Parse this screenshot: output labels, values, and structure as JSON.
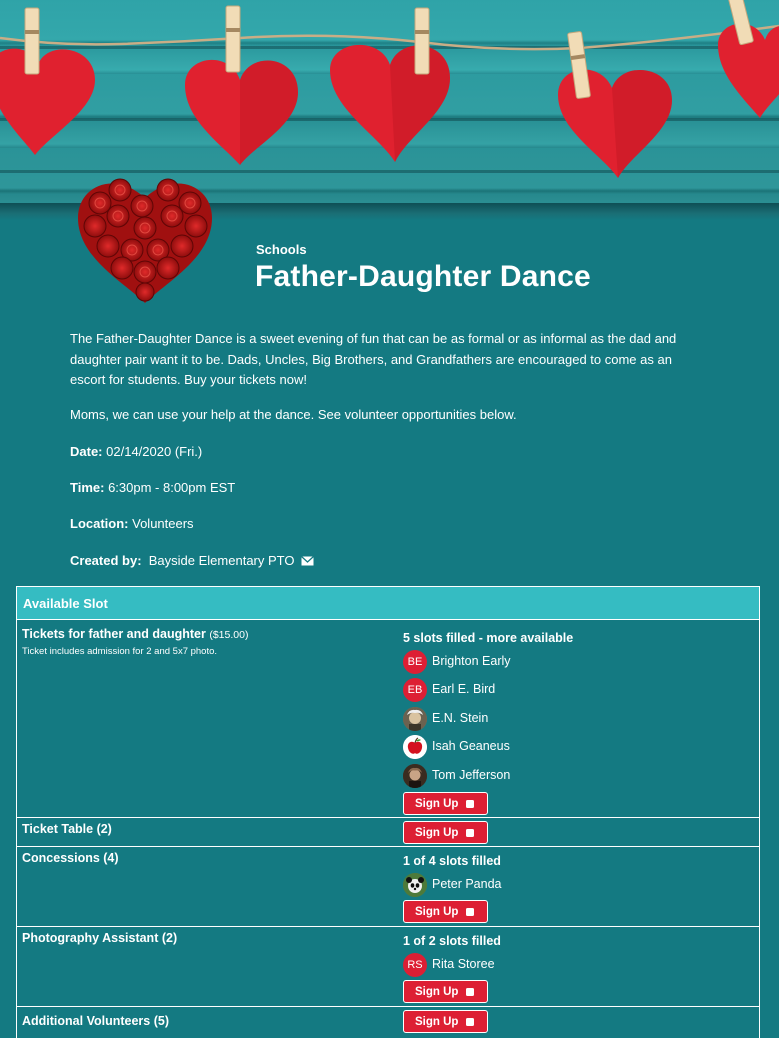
{
  "header": {
    "category": "Schools",
    "title": "Father-Daughter Dance"
  },
  "description": {
    "paragraph1": "The Father-Daughter Dance is a sweet evening of fun that can be as formal or as informal as the dad and daughter pair want it to be. Dads, Uncles, Big Brothers, and Grandfathers are encouraged to come as an escort for students. Buy your tickets now!",
    "paragraph2": "Moms, we can use your help at the dance. See volunteer opportunities below."
  },
  "details": {
    "date_label": "Date:",
    "date_value": "02/14/2020 (Fri.)",
    "time_label": "Time:",
    "time_value": "6:30pm - 8:00pm EST",
    "location_label": "Location:",
    "location_value": "Volunteers",
    "created_label": "Created by:",
    "created_value": "Bayside Elementary PTO"
  },
  "table": {
    "header": "Available Slot",
    "signup_label": "Sign Up",
    "rows": [
      {
        "title": "Tickets for father and daughter",
        "price": "($15.00)",
        "subtitle": "Ticket includes admission for 2 and 5x7 photo.",
        "status": "5 slots filled - more available",
        "people": [
          {
            "initials": "BE",
            "name": "Brighton Early",
            "avatar": "initials"
          },
          {
            "initials": "EB",
            "name": "Earl E. Bird",
            "avatar": "initials"
          },
          {
            "initials": "",
            "name": "E.N. Stein",
            "avatar": "einstein-photo"
          },
          {
            "initials": "",
            "name": "Isah Geaneus",
            "avatar": "apple-icon"
          },
          {
            "initials": "",
            "name": "Tom Jefferson",
            "avatar": "jefferson-photo"
          }
        ]
      },
      {
        "title": "Ticket Table (2)",
        "status": "",
        "people": []
      },
      {
        "title": "Concessions (4)",
        "status": "1 of 4 slots filled",
        "people": [
          {
            "initials": "",
            "name": "Peter Panda",
            "avatar": "panda-photo"
          }
        ]
      },
      {
        "title": "Photography Assistant (2)",
        "status": "1 of 2 slots filled",
        "people": [
          {
            "initials": "RS",
            "name": "Rita Storee",
            "avatar": "initials"
          }
        ]
      },
      {
        "title": "Additional Volunteers (5)",
        "status": "",
        "people": []
      }
    ]
  },
  "colors": {
    "page_bg": "#147a82",
    "table_header_bg": "#35bcc2",
    "accent_red": "#dd1f34"
  }
}
